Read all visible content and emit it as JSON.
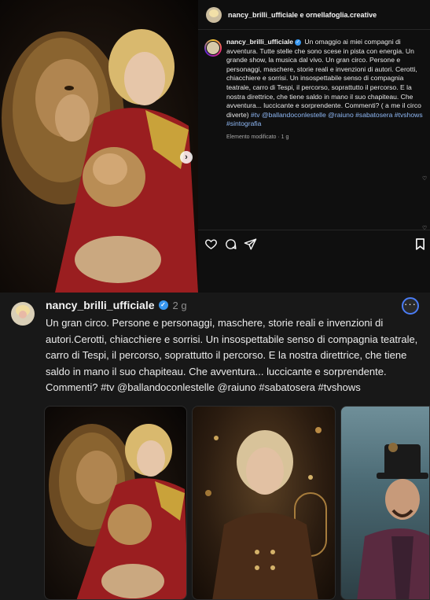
{
  "instagram": {
    "header_names": "nancy_brilli_ufficiale e ornellafoglia.creative",
    "caption_username": "nancy_brilli_ufficiale",
    "caption_text": "Un omaggio ai miei compagni di avventura. Tutte stelle che sono scese in pista con energia. Un grande show, la musica dal vivo. Un gran circo. Persone e personaggi, maschere, storie reali e invenzioni di autori. Cerotti, chiacchiere e sorrisi. Un insospettabile senso di compagnia teatrale, carro di Tespi, il percorso, soprattutto il percorso. E la nostra direttrice, che tiene saldo in mano il suo chapiteau. Che avventura... luccicante e sorprendente. Commenti? ( a me il circo diverte)",
    "caption_tags": "#tv @ballandoconlestelle @raiuno #sabatosera #tvshows #sintografia",
    "meta": "Elemento modificato · 1 g",
    "next_arrow": "›"
  },
  "threads": {
    "username": "nancy_brilli_ufficiale",
    "time": "2 g",
    "text": "Un gran circo. Persone e personaggi, maschere, storie reali e invenzioni di autori.Cerotti, chiacchiere e sorrisi. Un insospettabile senso di compagnia teatrale, carro di Tespi, il percorso, soprattutto il percorso. E la nostra direttrice, che tiene saldo in mano il suo chapiteau. Che avventura... luccicante e sorprendente. Commenti? #tv @ballandoconlestelle @raiuno #sabatosera #tvshows",
    "more": "···"
  },
  "icons": {
    "verified": "✓",
    "heart": "♡"
  },
  "colors": {
    "accent_blue": "#3897f0",
    "link": "#8fb8f5",
    "threads_bg": "#181818",
    "instagram_bg": "#0f0f0f"
  }
}
